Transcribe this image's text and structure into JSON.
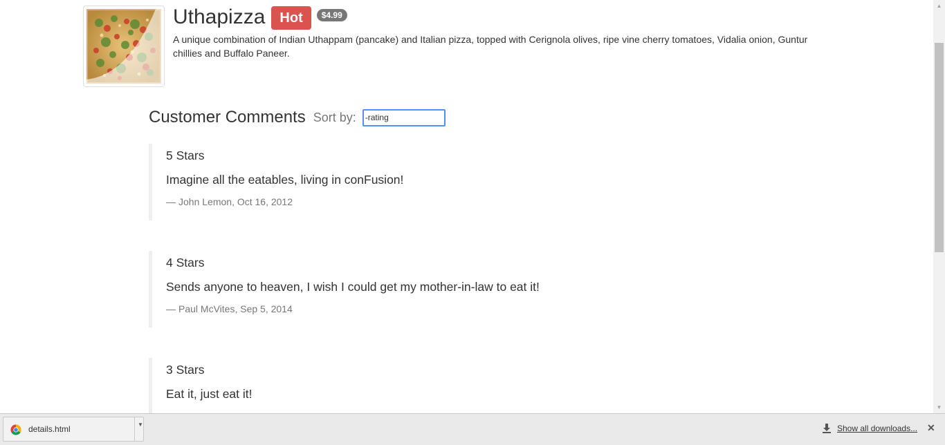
{
  "dish": {
    "name": "Uthapizza",
    "label": "Hot",
    "price": "$4.99",
    "description": "A unique combination of Indian Uthappam (pancake) and Italian pizza, topped with Cerignola olives, ripe vine cherry tomatoes, Vidalia onion, Guntur chillies and Buffalo Paneer.",
    "colors": {
      "label_bg": "#d9534f",
      "badge_bg": "#777777"
    }
  },
  "comments_section": {
    "title": "Customer Comments",
    "sort_label": "Sort by:",
    "sort_value": "-rating"
  },
  "comments": [
    {
      "rating": "5 Stars",
      "text": "Imagine all the eatables, living in conFusion!",
      "author": "John Lemon",
      "date": "Oct 16, 2012"
    },
    {
      "rating": "4 Stars",
      "text": "Sends anyone to heaven, I wish I could get my mother-in-law to eat it!",
      "author": "Paul McVites",
      "date": "Sep 5, 2014"
    },
    {
      "rating": "3 Stars",
      "text": "Eat it, just eat it!"
    }
  ],
  "downloads_bar": {
    "file_name": "details.html",
    "show_all": "Show all downloads...",
    "file_icon": "chrome-icon",
    "download_icon": "download-arrow-icon"
  }
}
